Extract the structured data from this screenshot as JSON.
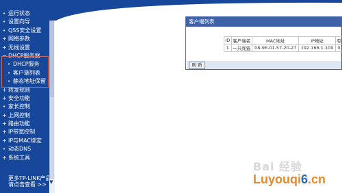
{
  "sidebar": {
    "items": [
      {
        "label": "运行状态"
      },
      {
        "label": "设置向导"
      },
      {
        "label": "QSS安全设置"
      },
      {
        "label": "网络参数"
      },
      {
        "label": "无线设置"
      },
      {
        "label": "DHCP服务器"
      }
    ],
    "submenu": [
      {
        "label": "DHCP服务"
      },
      {
        "label": "客户端列表"
      },
      {
        "label": "静态地址保留"
      }
    ],
    "items_after": [
      {
        "label": "转发规则"
      },
      {
        "label": "安全功能"
      },
      {
        "label": "家长控制"
      },
      {
        "label": "上网控制"
      },
      {
        "label": "路由功能"
      },
      {
        "label": "IP带宽控制"
      },
      {
        "label": "IP与MAC绑定"
      },
      {
        "label": "动态DNS"
      },
      {
        "label": "系统工具"
      }
    ],
    "more_text_1": "更多TP-LINK产品，",
    "more_text_2": "请点击查看 >>"
  },
  "client_panel": {
    "title": "客户端列表",
    "columns": [
      "ID",
      "客户端名",
      "MAC地址",
      "IP地址",
      "有"
    ],
    "rows": [
      [
        "1",
        "一只死猫",
        "08-9E-01-57-20-27",
        "192.168.1.100",
        "0"
      ]
    ],
    "refresh_label": "刷 新"
  },
  "watermark": {
    "baidu": "Bai 经验",
    "site_prefix": "Luyouqi",
    "site_six": "6",
    "site_suffix": ".cn"
  },
  "colors": {
    "sidebar_bg": "#16479a",
    "panel_header": "#3d62a8",
    "accent_orange": "#e38b2b"
  }
}
